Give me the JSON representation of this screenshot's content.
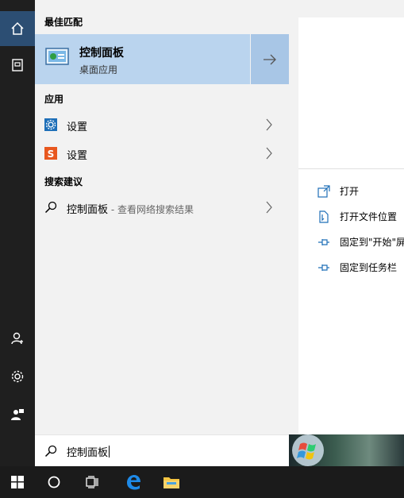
{
  "best_match": {
    "section_title": "最佳匹配",
    "title": "控制面板",
    "subtitle": "桌面应用"
  },
  "apps": {
    "section_title": "应用",
    "items": [
      {
        "label": "设置"
      },
      {
        "label": "设置"
      }
    ]
  },
  "suggestions": {
    "section_title": "搜索建议",
    "item_label": "控制面板",
    "item_hint": " - 查看网络搜索结果"
  },
  "actions": [
    {
      "label": "打开"
    },
    {
      "label": "打开文件位置"
    },
    {
      "label": "固定到\"开始\"屏"
    },
    {
      "label": "固定到任务栏"
    }
  ],
  "search": {
    "value": "控制面板"
  },
  "colors": {
    "accent": "#2c4e73",
    "highlight": "#bad4ee",
    "settings_icon": "#1e6fb8",
    "sogou_icon": "#e8571e"
  }
}
